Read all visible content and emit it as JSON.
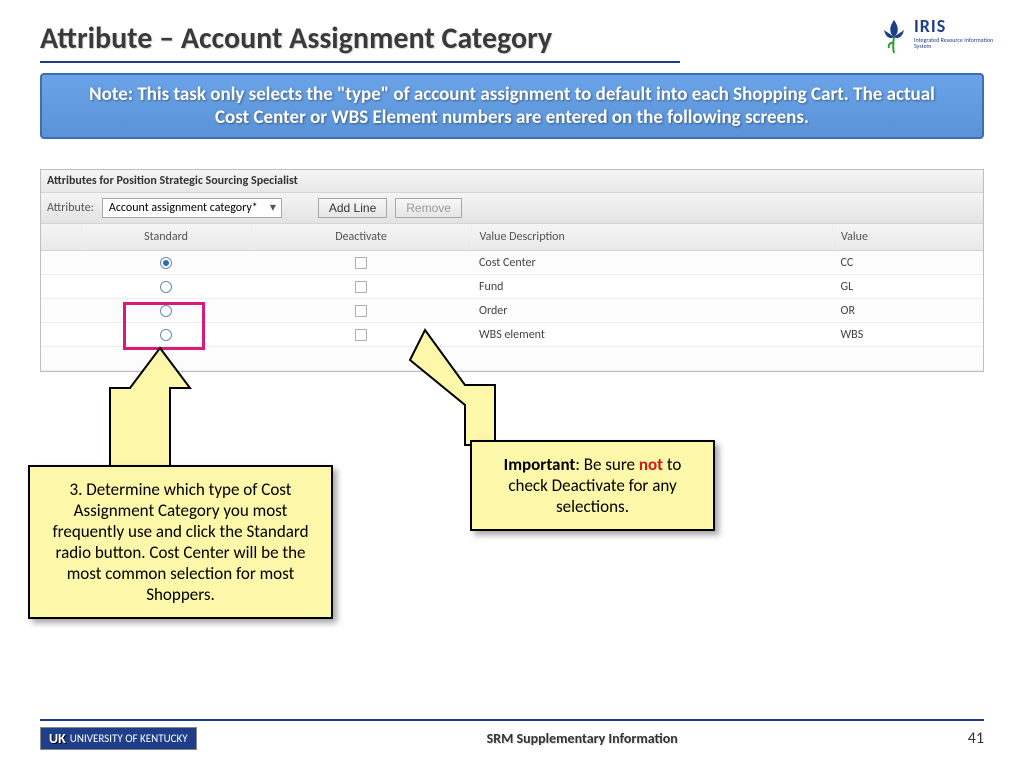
{
  "title": "Attribute – Account Assignment Category",
  "logo": {
    "name": "IRIS",
    "sub": "Integrated Resource Information System"
  },
  "note": "Note: This task only selects the \"type\" of account assignment to default into each Shopping Cart. The actual Cost Center or WBS Element numbers are entered on the following screens.",
  "panel": {
    "header": "Attributes for Position Strategic Sourcing Specialist",
    "attribute_label": "Attribute:",
    "dropdown_value": "Account assignment category*",
    "add_line_label": "Add Line",
    "remove_label": "Remove",
    "columns": {
      "standard": "Standard",
      "deactivate": "Deactivate",
      "vdesc": "Value Description",
      "value": "Value"
    },
    "rows": [
      {
        "selected": true,
        "desc": "Cost Center",
        "val": "CC"
      },
      {
        "selected": false,
        "desc": "Fund",
        "val": "GL"
      },
      {
        "selected": false,
        "desc": "Order",
        "val": "OR"
      },
      {
        "selected": false,
        "desc": "WBS element",
        "val": "WBS"
      }
    ]
  },
  "callouts": {
    "step3": "3. Determine which type of Cost Assignment Category you most frequently use and click the Standard radio button. Cost Center will be the most common selection for most Shoppers.",
    "important_prefix": "Important",
    "important_mid1": ": Be sure ",
    "important_not": "not",
    "important_mid2": " to check Deactivate for any selections."
  },
  "footer": {
    "uk_initials": "UK",
    "uk_text": "UNIVERSITY OF KENTUCKY",
    "center": "SRM Supplementary Information",
    "page": "41"
  }
}
